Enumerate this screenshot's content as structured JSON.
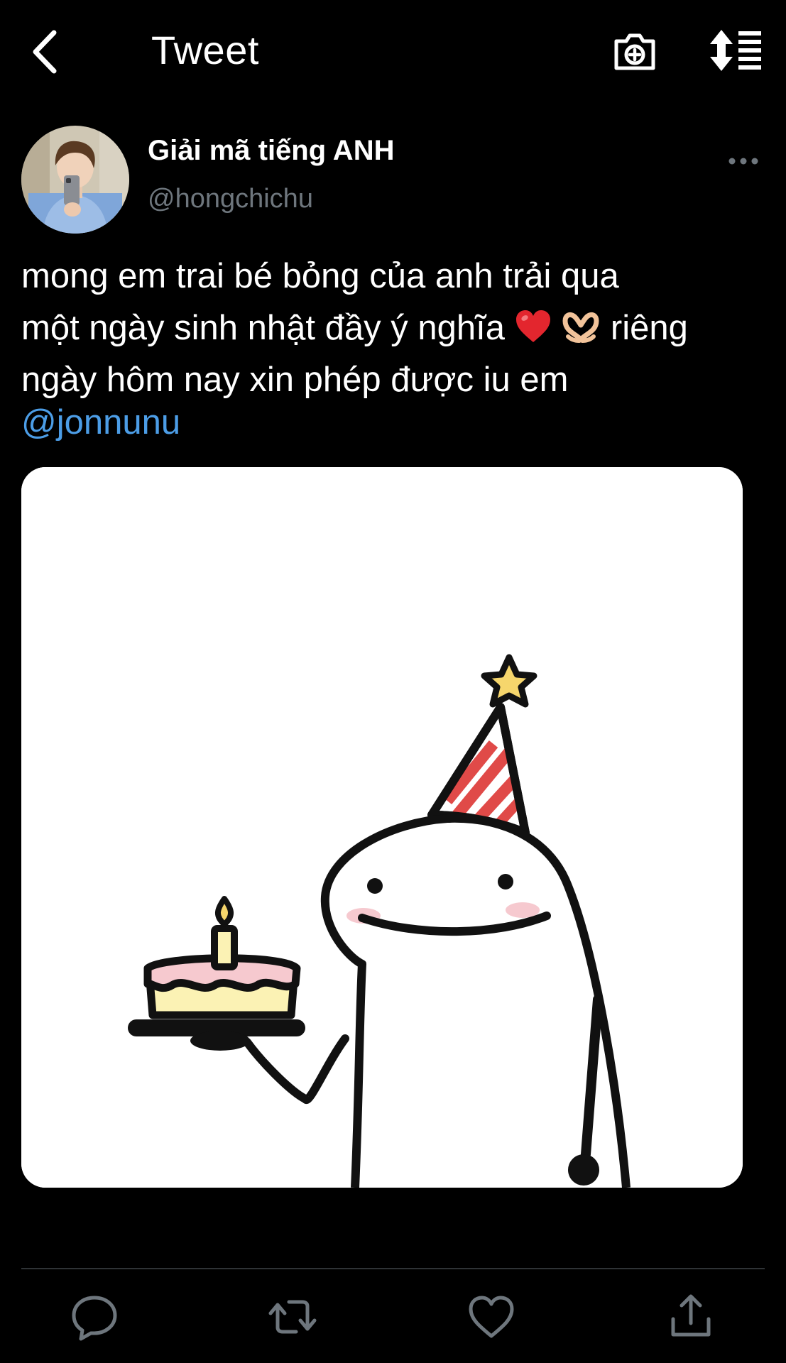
{
  "header": {
    "title": "Tweet",
    "back_icon": "chevron-left-icon",
    "camera_icon": "camera-plus-icon",
    "sort_icon": "sort-list-icon"
  },
  "tweet": {
    "author": {
      "display_name": "Giải mã tiếng ANH",
      "handle": "@hongchichu"
    },
    "text": {
      "line1": "mong em trai bé bỏng của anh trải qua",
      "line2_pre": "một ngày sinh nhật đầy ý nghĩa",
      "line2_post": "riêng",
      "line3": "ngày hôm nay xin phép được iu em",
      "mention": "@jonnunu"
    },
    "media": {
      "description_icon": "birthday-cake-illustration"
    }
  },
  "actions": {
    "reply_icon": "reply-bubble-icon",
    "retweet_icon": "retweet-icon",
    "like_icon": "heart-icon",
    "share_icon": "share-upload-icon"
  },
  "colors": {
    "background": "#000000",
    "text": "#ffffff",
    "handle": "#6e767d",
    "mention": "#4c9de6",
    "divider": "#2f3336"
  }
}
